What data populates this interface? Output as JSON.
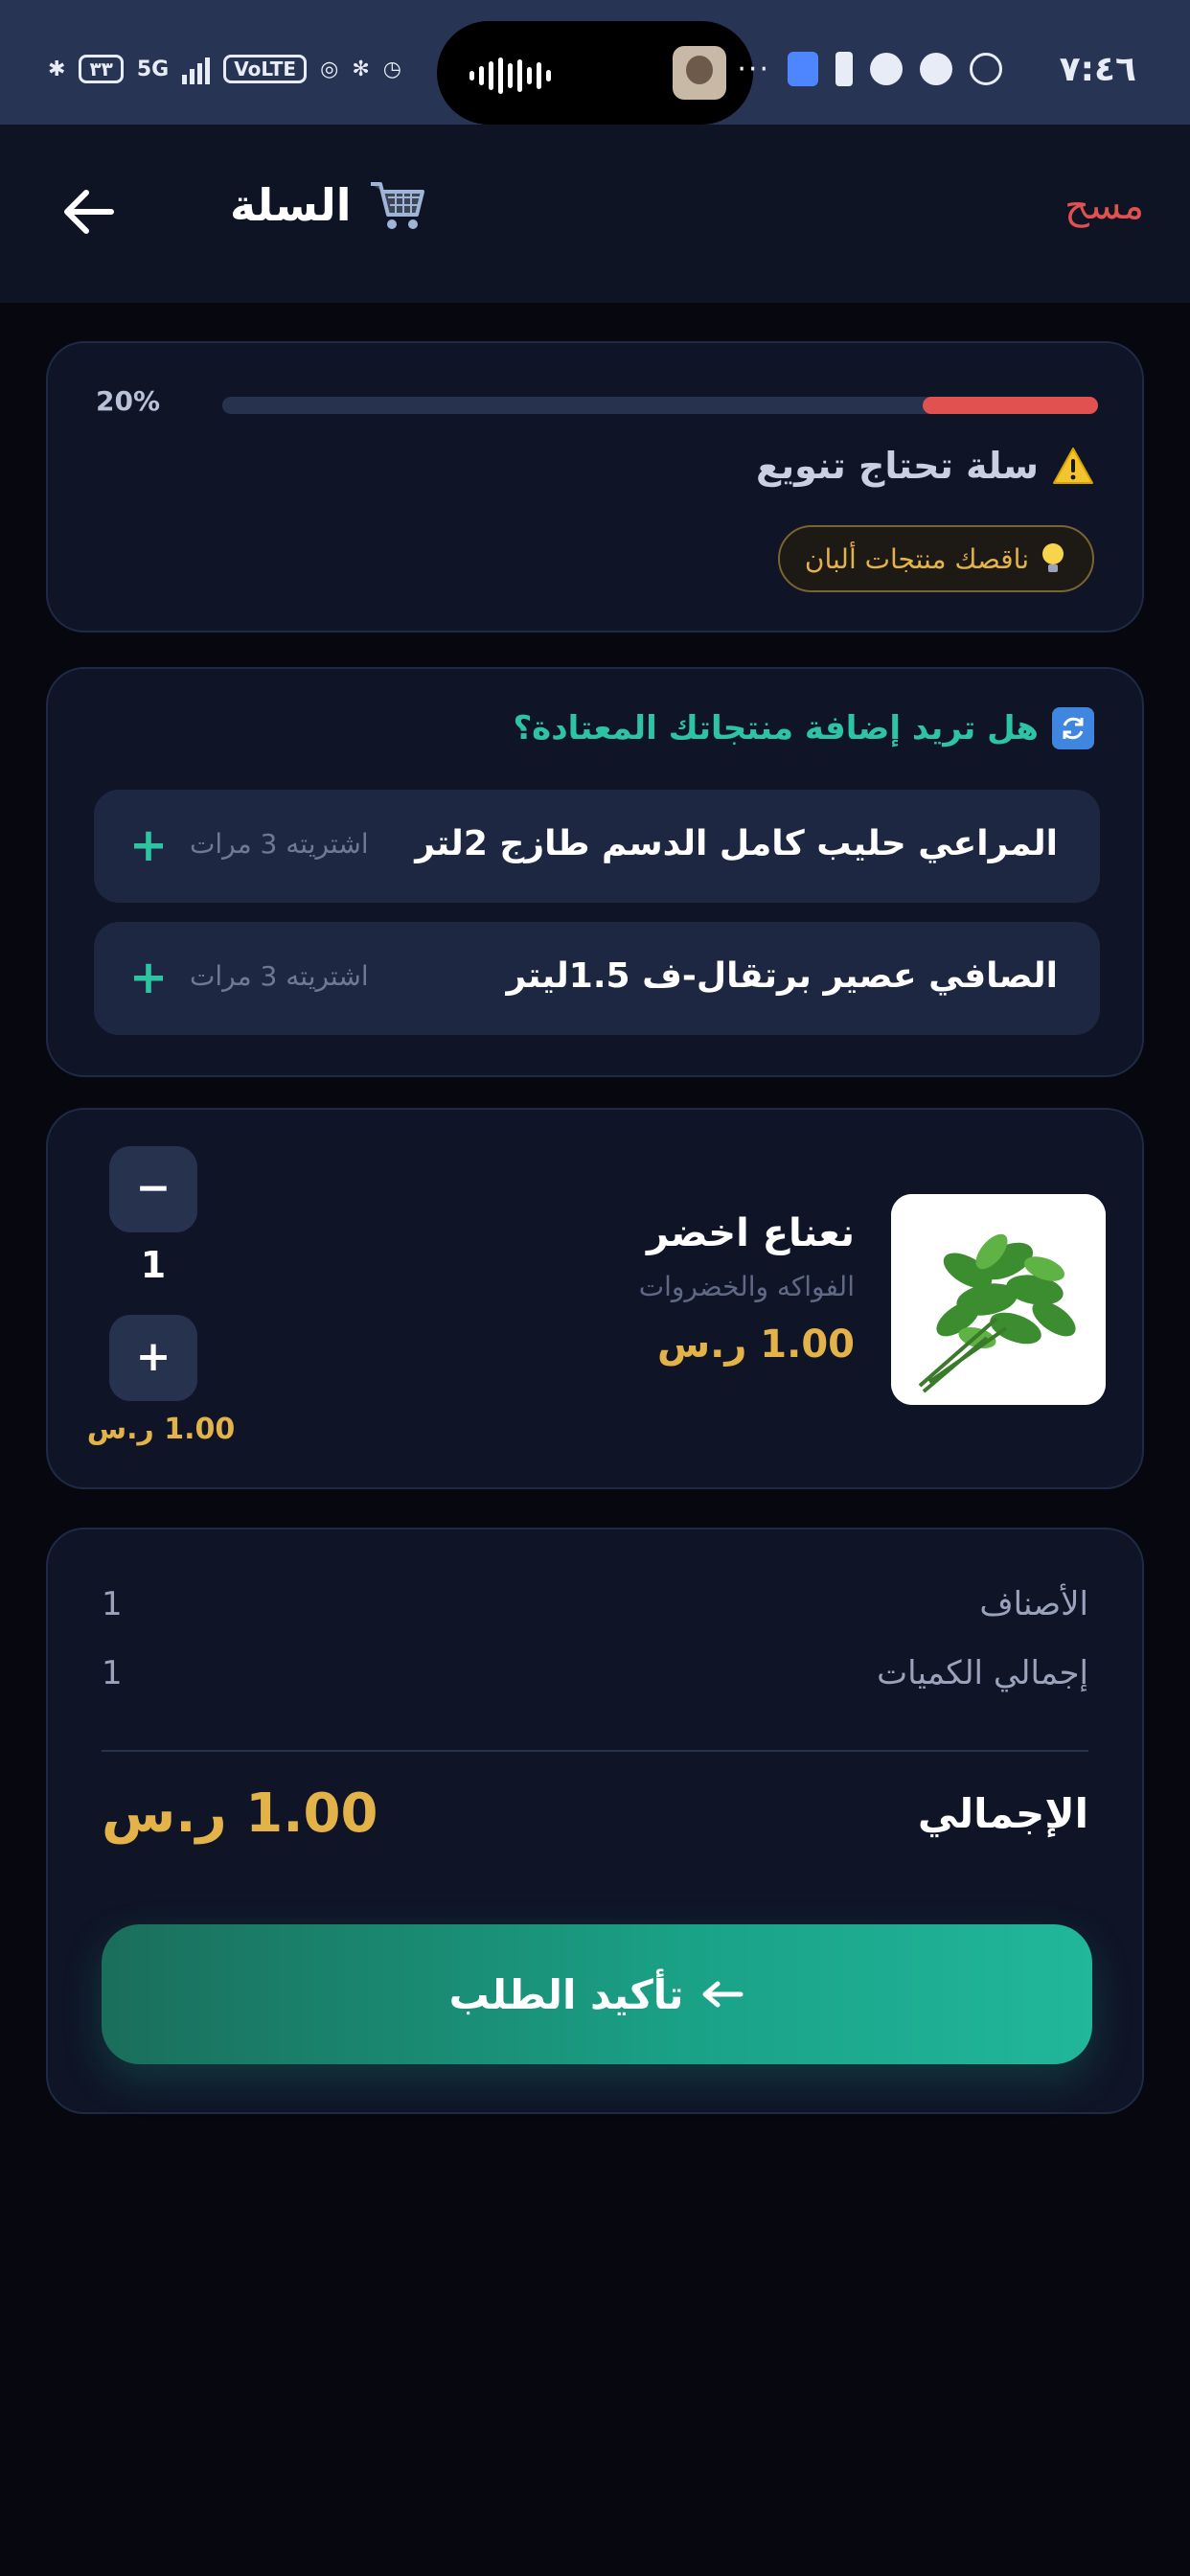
{
  "status_bar": {
    "time": "٧:٤٦",
    "left_badge": "٣٣",
    "network": "5G",
    "volte": "VoLTE"
  },
  "header": {
    "title": "السلة",
    "clear_label": "مسح",
    "icons": [
      "back-arrow-icon",
      "cart-icon"
    ]
  },
  "progress": {
    "percent_label": "20%",
    "percent_value": 0.2,
    "warning": "سلة تحتاج تنويع",
    "hint": "ناقصك منتجات ألبان",
    "fill_color": "#e0514f"
  },
  "suggestions": {
    "title": "هل تريد إضافة منتجاتك المعتادة؟",
    "items": [
      {
        "name": "المراعي حليب كامل الدسم طازج 2لتر",
        "meta": "اشتريته 3 مرات",
        "add": "+"
      },
      {
        "name": "الصافي عصير برتقال-ف 1.5ليتر",
        "meta": "اشتريته 3 مرات",
        "add": "+"
      }
    ]
  },
  "cart_item": {
    "name": "نعناع اخضر",
    "category": "الفواكه والخضروات",
    "price": "1.00 ر.س",
    "quantity": "1",
    "line_total": "1.00 ر.س",
    "minus": "−",
    "plus": "+"
  },
  "summary": {
    "items_label": "الأصناف",
    "items_value": "1",
    "qty_label": "إجمالي الكميات",
    "qty_value": "1",
    "total_label": "الإجمالي",
    "total_value": "1.00 ر.س",
    "confirm_label": "تأكيد الطلب"
  },
  "colors": {
    "background": "#07080f",
    "card": "#0f1527",
    "accent_green": "#2cc4a3",
    "gold": "#e3b34a",
    "danger": "#e0514f"
  }
}
